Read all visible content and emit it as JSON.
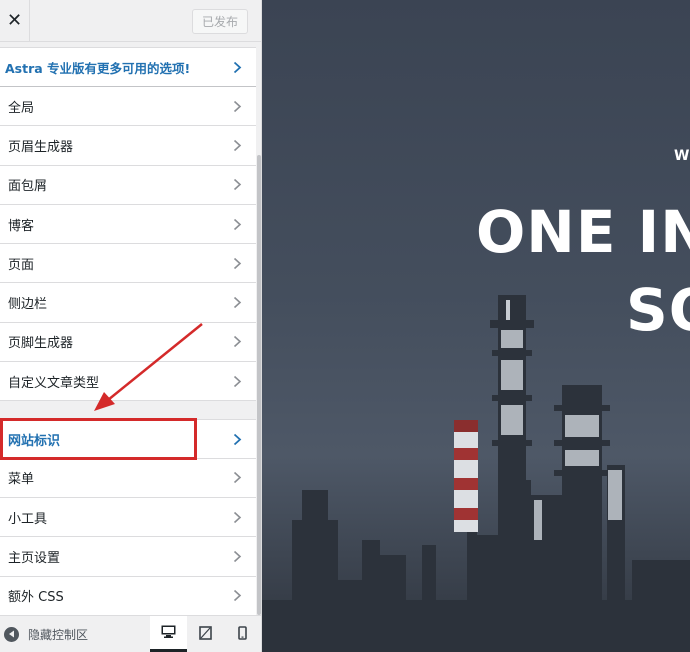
{
  "topbar": {
    "close_label": "✕",
    "publish_label": "已发布"
  },
  "menu": {
    "promo_label": "Astra 专业版有更多可用的选项!",
    "items": [
      {
        "label": "全局"
      },
      {
        "label": "页眉生成器"
      },
      {
        "label": "面包屑"
      },
      {
        "label": "博客"
      },
      {
        "label": "页面"
      },
      {
        "label": "侧边栏"
      },
      {
        "label": "页脚生成器"
      },
      {
        "label": "自定义文章类型"
      }
    ],
    "items2": [
      {
        "label": "网站标识"
      },
      {
        "label": "菜单"
      },
      {
        "label": "小工具"
      },
      {
        "label": "主页设置"
      },
      {
        "label": "额外 CSS"
      }
    ]
  },
  "footer": {
    "collapse_label": "隐藏控制区",
    "devices": [
      "desktop-icon",
      "tablet-icon",
      "mobile-icon"
    ]
  },
  "preview": {
    "eyebrow": "WE",
    "line1": "ONE IN",
    "line2": "SO"
  },
  "colors": {
    "accent": "#2271b1",
    "highlight": "#d42a2a"
  }
}
